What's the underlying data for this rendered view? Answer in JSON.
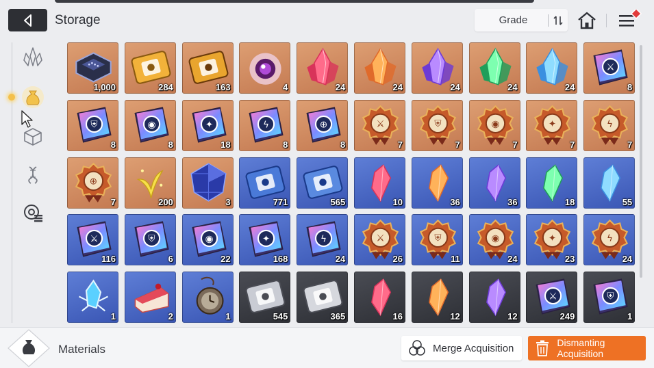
{
  "header": {
    "title": "Storage",
    "grade_label": "Grade"
  },
  "sidebar": {
    "items": [
      "crystals",
      "materials",
      "cube",
      "dna",
      "badge"
    ],
    "active": "materials"
  },
  "items": [
    {
      "qty": "1,000",
      "bg": "orange",
      "icon": "chip-icon"
    },
    {
      "qty": "284",
      "bg": "orange",
      "icon": "gold-ticket-icon"
    },
    {
      "qty": "163",
      "bg": "orange",
      "icon": "gold-compass-ticket-icon"
    },
    {
      "qty": "4",
      "bg": "orange",
      "icon": "purple-eye-orb-icon"
    },
    {
      "qty": "24",
      "bg": "orange",
      "icon": "red-crystal-icon"
    },
    {
      "qty": "24",
      "bg": "orange",
      "icon": "orange-crystal-icon"
    },
    {
      "qty": "24",
      "bg": "orange",
      "icon": "purple-crystal-icon"
    },
    {
      "qty": "24",
      "bg": "orange",
      "icon": "green-crystal-icon"
    },
    {
      "qty": "24",
      "bg": "orange",
      "icon": "blue-crystal-icon"
    },
    {
      "qty": "8",
      "bg": "orange",
      "icon": "sword-book-icon"
    },
    {
      "qty": "8",
      "bg": "orange",
      "icon": "shield-book-icon"
    },
    {
      "qty": "8",
      "bg": "orange",
      "icon": "eye-book-icon"
    },
    {
      "qty": "18",
      "bg": "orange",
      "icon": "wing-book-icon"
    },
    {
      "qty": "8",
      "bg": "orange",
      "icon": "bolt-book-icon"
    },
    {
      "qty": "8",
      "bg": "orange",
      "icon": "target-book-icon"
    },
    {
      "qty": "7",
      "bg": "orange",
      "icon": "sword-medal-icon"
    },
    {
      "qty": "7",
      "bg": "orange",
      "icon": "shield-medal-icon"
    },
    {
      "qty": "7",
      "bg": "orange",
      "icon": "eye-medal-icon"
    },
    {
      "qty": "7",
      "bg": "orange",
      "icon": "wing-medal-icon"
    },
    {
      "qty": "7",
      "bg": "orange",
      "icon": "bolt-medal-icon"
    },
    {
      "qty": "7",
      "bg": "orange",
      "icon": "target-medal-icon"
    },
    {
      "qty": "200",
      "bg": "orange",
      "icon": "yellow-sprout-icon"
    },
    {
      "qty": "3",
      "bg": "orange",
      "icon": "blue-cube-gem-icon"
    },
    {
      "qty": "771",
      "bg": "blue",
      "icon": "blue-ticket-icon"
    },
    {
      "qty": "565",
      "bg": "blue",
      "icon": "blue-compass-ticket-icon"
    },
    {
      "qty": "10",
      "bg": "blue",
      "icon": "red-shard-icon"
    },
    {
      "qty": "36",
      "bg": "blue",
      "icon": "orange-shard-icon"
    },
    {
      "qty": "36",
      "bg": "blue",
      "icon": "purple-shard-icon"
    },
    {
      "qty": "18",
      "bg": "blue",
      "icon": "green-shard-icon"
    },
    {
      "qty": "55",
      "bg": "blue",
      "icon": "blue-shard-icon"
    },
    {
      "qty": "116",
      "bg": "blue",
      "icon": "sword-book-icon"
    },
    {
      "qty": "6",
      "bg": "blue",
      "icon": "shield-book-icon"
    },
    {
      "qty": "22",
      "bg": "blue",
      "icon": "eye-book-icon"
    },
    {
      "qty": "168",
      "bg": "blue",
      "icon": "wing-book-icon"
    },
    {
      "qty": "24",
      "bg": "blue",
      "icon": "bolt-book-icon"
    },
    {
      "qty": "26",
      "bg": "blue",
      "icon": "sword-medal-icon"
    },
    {
      "qty": "11",
      "bg": "blue",
      "icon": "shield-medal-icon"
    },
    {
      "qty": "24",
      "bg": "blue",
      "icon": "eye-medal-icon"
    },
    {
      "qty": "23",
      "bg": "blue",
      "icon": "wing-medal-icon"
    },
    {
      "qty": "24",
      "bg": "blue",
      "icon": "bolt-medal-icon"
    },
    {
      "qty": "1",
      "bg": "blue",
      "icon": "ice-crystal-icon"
    },
    {
      "qty": "2",
      "bg": "blue",
      "icon": "cake-slice-icon"
    },
    {
      "qty": "1",
      "bg": "blue",
      "icon": "pocket-watch-icon"
    },
    {
      "qty": "545",
      "bg": "dark",
      "icon": "silver-ticket-icon"
    },
    {
      "qty": "365",
      "bg": "dark",
      "icon": "silver-compass-ticket-icon"
    },
    {
      "qty": "16",
      "bg": "dark",
      "icon": "red-shard-icon"
    },
    {
      "qty": "12",
      "bg": "dark",
      "icon": "orange-shard-icon"
    },
    {
      "qty": "12",
      "bg": "dark",
      "icon": "purple-shard-icon"
    },
    {
      "qty": "249",
      "bg": "dark",
      "icon": "sword-book-icon"
    },
    {
      "qty": "1",
      "bg": "dark",
      "icon": "shield-book-icon"
    }
  ],
  "footer": {
    "category_label": "Materials",
    "merge_label": "Merge Acquisition",
    "dismantle_label": "Dismanting Acquisition"
  },
  "colors": {
    "accent": "#ee7124",
    "active_glow": "#f4c04a"
  }
}
